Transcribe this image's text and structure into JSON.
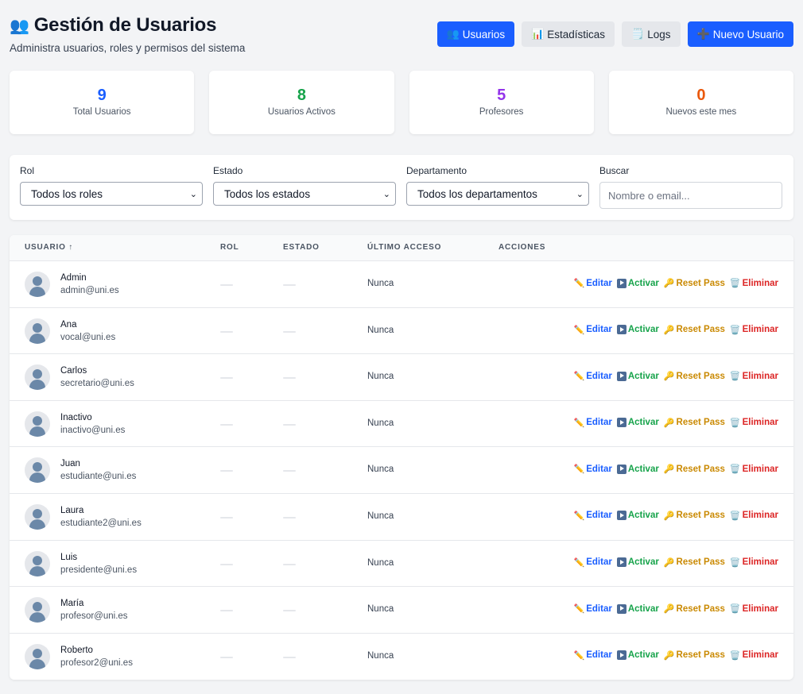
{
  "header": {
    "icon": "users-icon",
    "title": "Gestión de Usuarios",
    "subtitle": "Administra usuarios, roles y permisos del sistema",
    "buttons": {
      "usuarios": "Usuarios",
      "estadisticas": "Estadísticas",
      "logs": "Logs",
      "nuevo": "Nuevo Usuario"
    }
  },
  "stats": [
    {
      "value": "9",
      "label": "Total Usuarios",
      "color": "#1a5eff"
    },
    {
      "value": "8",
      "label": "Usuarios Activos",
      "color": "#16a34a"
    },
    {
      "value": "5",
      "label": "Profesores",
      "color": "#9333ea"
    },
    {
      "value": "0",
      "label": "Nuevos este mes",
      "color": "#ea580c"
    }
  ],
  "filters": {
    "rol": {
      "label": "Rol",
      "value": "Todos los roles"
    },
    "estado": {
      "label": "Estado",
      "value": "Todos los estados"
    },
    "departamento": {
      "label": "Departamento",
      "value": "Todos los departamentos"
    },
    "buscar": {
      "label": "Buscar",
      "placeholder": "Nombre o email..."
    }
  },
  "table": {
    "columns": {
      "usuario": "USUARIO ↑",
      "rol": "ROL",
      "estado": "ESTADO",
      "acceso": "ÚLTIMO ACCESO",
      "acciones": "ACCIONES"
    },
    "actions": {
      "editar": "Editar",
      "activar": "Activar",
      "reset": "Reset Pass",
      "eliminar": "Eliminar"
    },
    "rows": [
      {
        "name": "Admin",
        "email": "admin@uni.es",
        "access": "Nunca"
      },
      {
        "name": "Ana",
        "email": "vocal@uni.es",
        "access": "Nunca"
      },
      {
        "name": "Carlos",
        "email": "secretario@uni.es",
        "access": "Nunca"
      },
      {
        "name": "Inactivo",
        "email": "inactivo@uni.es",
        "access": "Nunca"
      },
      {
        "name": "Juan",
        "email": "estudiante@uni.es",
        "access": "Nunca"
      },
      {
        "name": "Laura",
        "email": "estudiante2@uni.es",
        "access": "Nunca"
      },
      {
        "name": "Luis",
        "email": "presidente@uni.es",
        "access": "Nunca"
      },
      {
        "name": "María",
        "email": "profesor@uni.es",
        "access": "Nunca"
      },
      {
        "name": "Roberto",
        "email": "profesor2@uni.es",
        "access": "Nunca"
      }
    ]
  },
  "colors": {
    "primary": "#1a5eff",
    "edit": "#1a5eff",
    "activate": "#16a34a",
    "reset": "#ca8a04",
    "delete": "#dc2626"
  }
}
